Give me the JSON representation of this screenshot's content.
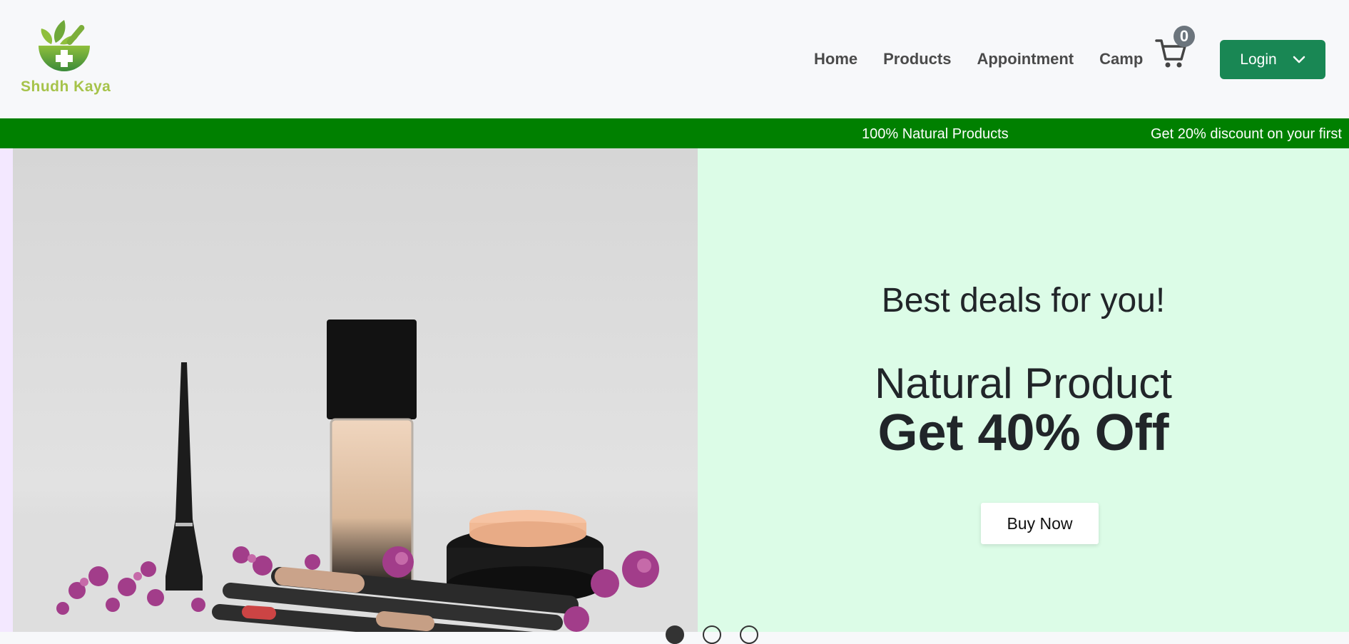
{
  "brand": {
    "name": "Shudh Kaya",
    "primary_color": "#198754",
    "ticker_color": "#008000"
  },
  "nav": {
    "items": [
      {
        "label": "Home"
      },
      {
        "label": "Products"
      },
      {
        "label": "Appointment"
      },
      {
        "label": "Camp"
      }
    ]
  },
  "cart": {
    "count": "0",
    "icon": "shopping-cart-icon"
  },
  "login": {
    "label": "Login",
    "icon": "chevron-down-icon"
  },
  "ticker": {
    "items": [
      "100% Natural Products",
      "Get 20% discount on your first"
    ]
  },
  "hero": {
    "subtitle": "Best deals for you!",
    "title": "Natural Product",
    "offer": "Get 40% Off",
    "button": "Buy Now",
    "background": "#dcfce7",
    "slides": 3,
    "active_slide": 1
  }
}
